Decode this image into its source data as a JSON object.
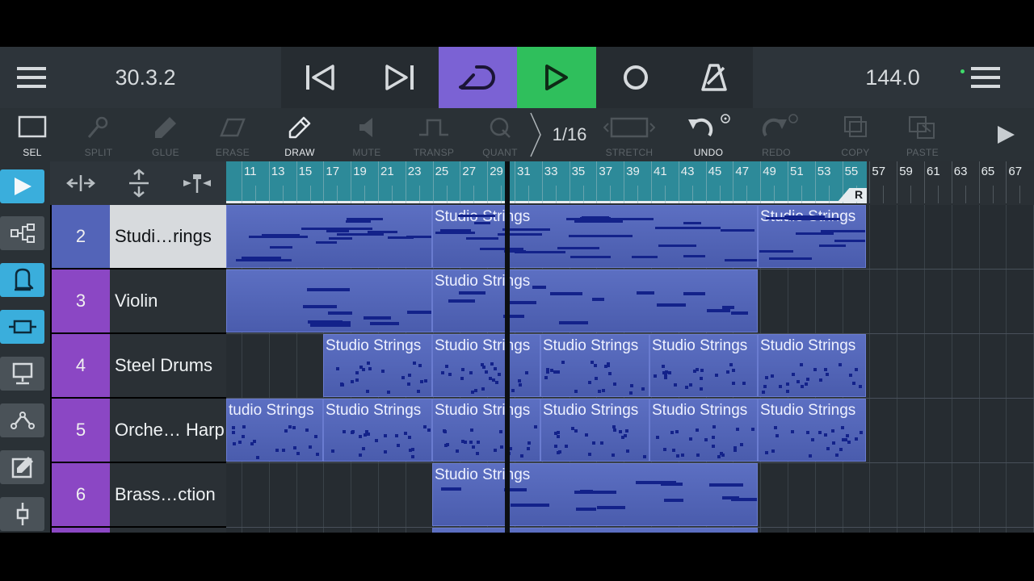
{
  "transport": {
    "position": "30.3.2",
    "tempo": "144.0",
    "colors": {
      "loop": "#7b62d4",
      "play": "#2fbf5c"
    },
    "icons": [
      "menu-icon",
      "skip-back-icon",
      "skip-forward-icon",
      "loop-icon",
      "play-icon",
      "record-icon",
      "metronome-icon",
      "menu-icon"
    ]
  },
  "tools": [
    {
      "label": "SEL",
      "icon": "select-rect-icon",
      "state": "on"
    },
    {
      "label": "SPLIT",
      "icon": "split-icon",
      "state": "off"
    },
    {
      "label": "GLUE",
      "icon": "glue-icon",
      "state": "off"
    },
    {
      "label": "ERASE",
      "icon": "eraser-icon",
      "state": "off"
    },
    {
      "label": "DRAW",
      "icon": "pencil-icon",
      "state": "on"
    },
    {
      "label": "MUTE",
      "icon": "mute-icon",
      "state": "off"
    },
    {
      "label": "TRANSP",
      "icon": "transpose-icon",
      "state": "off"
    },
    {
      "label": "QUANT",
      "icon": "quantize-icon",
      "state": "off"
    },
    {
      "label": "STRETCH",
      "icon": "stretch-icon",
      "state": "off"
    },
    {
      "label": "UNDO",
      "icon": "undo-icon",
      "state": "on"
    },
    {
      "label": "REDO",
      "icon": "redo-icon",
      "state": "off"
    },
    {
      "label": "COPY",
      "icon": "copy-icon",
      "state": "off"
    },
    {
      "label": "PASTE",
      "icon": "paste-icon",
      "state": "off"
    }
  ],
  "quantize_value": "1/16",
  "ruler": {
    "numbers": [
      "11",
      "13",
      "15",
      "17",
      "19",
      "21",
      "23",
      "25",
      "27",
      "29",
      "31",
      "33",
      "35",
      "37",
      "39",
      "41",
      "43",
      "45",
      "47",
      "49",
      "51",
      "53",
      "55",
      "57",
      "59",
      "61",
      "63",
      "65",
      "67"
    ],
    "marker_label": "R"
  },
  "tracks": [
    {
      "number": "2",
      "name": "Studi…rings",
      "color": "#5364b8",
      "selected": true
    },
    {
      "number": "3",
      "name": "Violin",
      "color": "#8b47c4",
      "selected": false
    },
    {
      "number": "4",
      "name": "Steel Drums",
      "color": "#8b47c4",
      "selected": false
    },
    {
      "number": "5",
      "name": "Orche… Harp",
      "color": "#8b47c4",
      "selected": false
    },
    {
      "number": "6",
      "name": "Brass…ction",
      "color": "#8b47c4",
      "selected": false
    }
  ],
  "clip_label": "Studio Strings",
  "clip_label_cut": "tudio Strings"
}
